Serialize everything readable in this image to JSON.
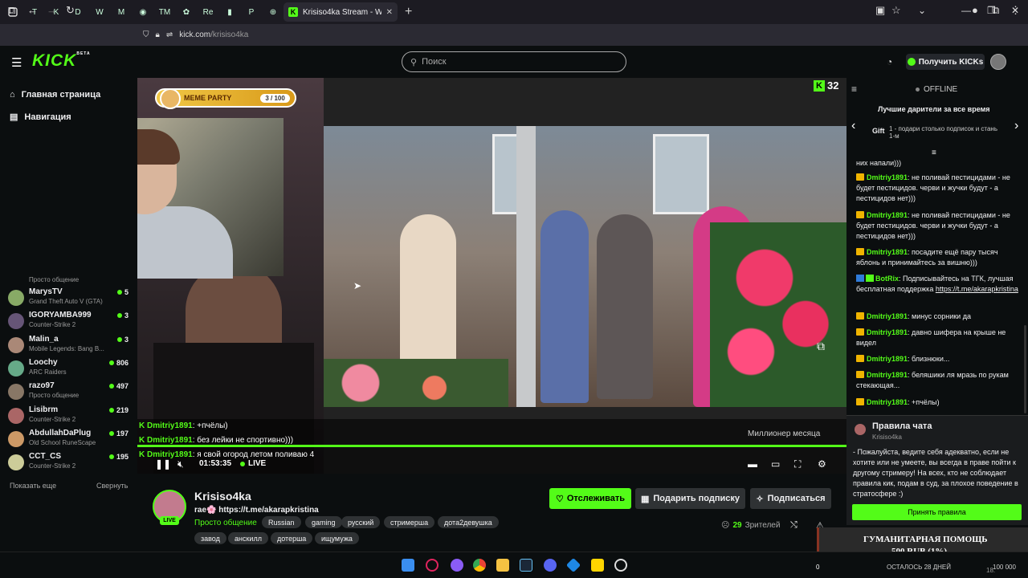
{
  "browser": {
    "active_tab_title": "Krisiso4ka Stream - Watch",
    "url_domain": "kick.com",
    "url_path": "/krisiso4ka",
    "mini_tabs": [
      "T",
      "K",
      "D",
      "W",
      "M",
      "◉",
      "TM",
      "✿",
      "Re",
      "▮",
      "P",
      "⊕"
    ]
  },
  "header": {
    "logo": "KICK",
    "logo_beta": "BETA",
    "search_placeholder": "Поиск",
    "kicks_button": "Получить KICKs"
  },
  "sidebar": {
    "home": "Главная страница",
    "nav": "Навигация",
    "partial_category": "Просто общение",
    "channels": [
      {
        "name": "MarysTV",
        "category": "Grand Theft Auto V (GTA)",
        "viewers": "5"
      },
      {
        "name": "IGORYAMBA999",
        "category": "Counter-Strike 2",
        "viewers": "3"
      },
      {
        "name": "Malin_a",
        "category": "Mobile Legends: Bang B...",
        "viewers": "3"
      },
      {
        "name": "Loochy",
        "category": "ARC Raiders",
        "viewers": "806"
      },
      {
        "name": "razo97",
        "category": "Просто общение",
        "viewers": "497"
      },
      {
        "name": "Lisibrm",
        "category": "Counter-Strike 2",
        "viewers": "219"
      },
      {
        "name": "AbdullahDaPlug",
        "category": "Old School RuneScape",
        "viewers": "197"
      },
      {
        "name": "CCT_CS",
        "category": "Counter-Strike 2",
        "viewers": "195"
      }
    ],
    "show_more": "Показать еще",
    "collapse": "Свернуть"
  },
  "video": {
    "meme_label": "MEME PARTY",
    "meme_count": "3 / 100",
    "corner_count": "32",
    "overlay_chat": [
      {
        "user": "Dmitriy1891",
        "text": ": +пчёлы)"
      },
      {
        "user": "Dmitriy1891",
        "text": ": без лейки не спортивно)))"
      },
      {
        "user": "Dmitriy1891",
        "text": ": я свой огород летом поливаю 4"
      }
    ],
    "overlay_right": "Миллионер месяца",
    "time": "01:53:35",
    "live": "LIVE"
  },
  "channel": {
    "name": "Krisiso4ka",
    "avatar_badge": "LIVE",
    "title_prefix": "rae🌸",
    "title_link": "https://t.me/akarapkristina",
    "category": "Просто общение",
    "tags_row1": [
      "Russian",
      "gaming",
      "русский",
      "стримерша",
      "дота2девушка"
    ],
    "tags_row2": [
      "завод",
      "анскилл",
      "дотерша",
      "ищумужа"
    ],
    "follow": "Отслеживать",
    "gift_sub": "Подарить подписку",
    "subscribe": "Подписаться",
    "viewers_count": "29",
    "viewers_label": "Зрителей"
  },
  "chat": {
    "status": "OFFLINE",
    "gifters_title": "Лучшие дарители за все время",
    "gifters_label": "Gift",
    "gifters_desc": "1 - подари столько подписок и стань 1-м",
    "partial_top": "них напали)))",
    "messages": [
      {
        "user": "Dmitriy1891",
        "text": ": не поливай пестицидами - не будет пестицидов. черви и жучки будут - а пестицидов нет)))",
        "type": "crown"
      },
      {
        "user": "Dmitriy1891",
        "text": ": не поливай пестицидами - не будет пестицидов. черви и жучки будут - а пестицидов нет)))",
        "type": "crown"
      },
      {
        "user": "Dmitriy1891",
        "text": ": посадите ещё пару тысяч яблонь и принимайтесь за вишню)))",
        "type": "crown"
      },
      {
        "user": "BotRix",
        "text": ": Подписывайтесь на ТГК, лучшая бесплатная поддержка ",
        "link": "https://t.me/akarapkristina",
        "type": "bot"
      },
      {
        "user": "Dmitriy1891",
        "text": ": минус сорники да",
        "type": "crown"
      },
      {
        "user": "Dmitriy1891",
        "text": ": давно шифера на крыше не видел",
        "type": "crown"
      },
      {
        "user": "Dmitriy1891",
        "text": ": близнюки...",
        "type": "crown"
      },
      {
        "user": "Dmitriy1891",
        "text": ": беляшики ля мразь по рукам стекающая...",
        "type": "crown"
      },
      {
        "user": "Dmitriy1891",
        "text": ": +пчёлы)",
        "type": "crown"
      }
    ],
    "rules_title": "Правила чата",
    "rules_sub": "Krisiso4ka",
    "rules_text": "- Пожалуйста, ведите себя адекватно, если не хотите или не умеете, вы всегда в праве пойти к другому стримеру! На всех, кто не соблюдает правила кик, подам в суд, за плохое поведение в стратосфере :)",
    "rules_button": "Принять правила"
  },
  "donation": {
    "title": "ГУМАНИТАРНАЯ ПОМОЩЬ",
    "sum": "500 RUB (1%)",
    "left_zero": "0",
    "remaining": "ОСТАЛОСЬ 28 ДНЕЙ",
    "goal": "100 000",
    "date": "18."
  },
  "colors": {
    "accent": "#53fc18",
    "background": "#0b0e0f",
    "tag_bg": "#2f3234"
  }
}
